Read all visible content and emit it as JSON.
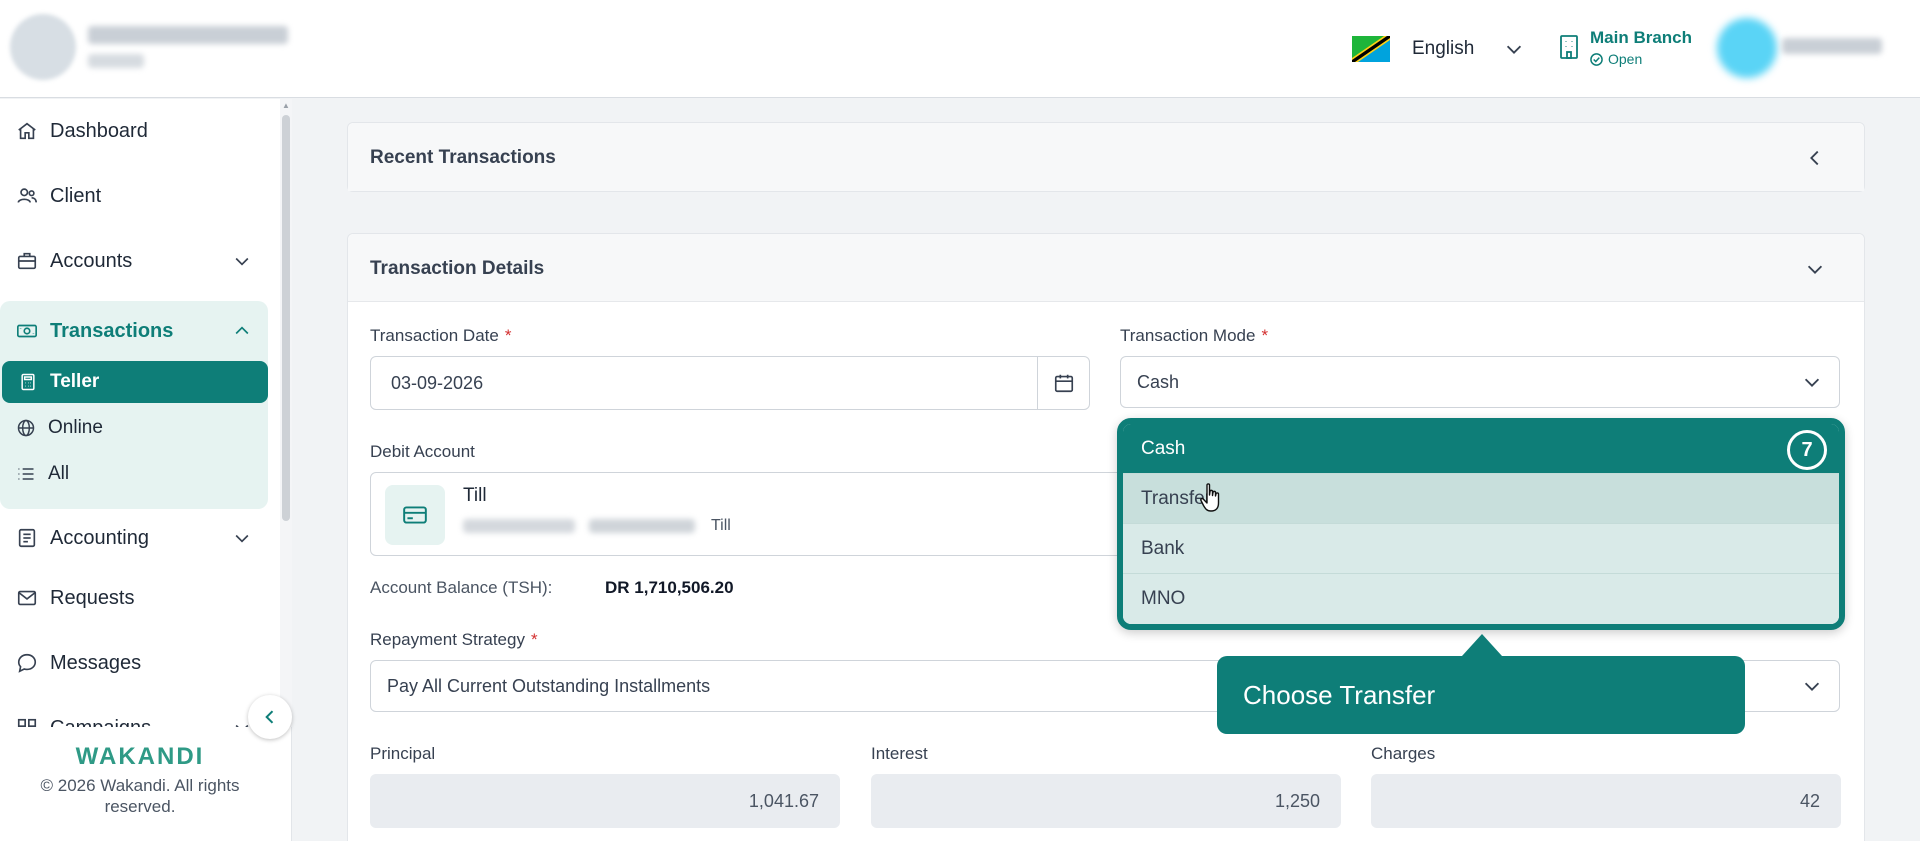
{
  "header": {
    "language": "English",
    "branch_name": "Main Branch",
    "branch_status": "Open"
  },
  "sidebar": {
    "items": {
      "dashboard": "Dashboard",
      "client": "Client",
      "accounts": "Accounts",
      "transactions": "Transactions",
      "teller": "Teller",
      "online": "Online",
      "all": "All",
      "accounting": "Accounting",
      "requests": "Requests",
      "messages": "Messages",
      "campaigns": "Campaigns"
    },
    "brand": "WAKANDI",
    "copyright": "© 2026 Wakandi. All rights reserved."
  },
  "recent": {
    "title": "Recent Transactions"
  },
  "details": {
    "title": "Transaction Details",
    "date_label": "Transaction Date",
    "date_value": "03-09-2026",
    "mode_label": "Transaction Mode",
    "mode_value": "Cash",
    "debit_label": "Debit Account",
    "account_name": "Till",
    "account_type": "Till",
    "balance_label": "Account Balance (TSH):",
    "balance_value": "DR 1,710,506.20",
    "strategy_label": "Repayment Strategy",
    "strategy_value": "Pay All Current Outstanding Installments",
    "principal_label": "Principal",
    "principal_value": "1,041.67",
    "interest_label": "Interest",
    "interest_value": "1,250",
    "charges_label": "Charges",
    "charges_value": "42",
    "required_mark": "*"
  },
  "dropdown": {
    "options": [
      "Cash",
      "Transfer",
      "Bank",
      "MNO"
    ],
    "selected": "Cash",
    "hovered": "Transfer",
    "step_number": "7"
  },
  "tooltip": {
    "text": "Choose Transfer"
  },
  "colors": {
    "accent": "#0e7e78",
    "accent_light": "#e6f3f1",
    "required": "#d32f2f"
  }
}
